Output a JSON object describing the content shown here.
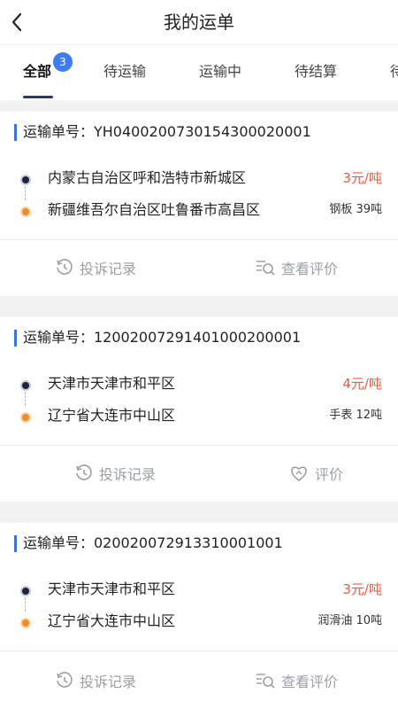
{
  "header": {
    "title": "我的运单"
  },
  "tabs": [
    {
      "label": "全部",
      "badge": "3",
      "active": true
    },
    {
      "label": "待运输"
    },
    {
      "label": "运输中"
    },
    {
      "label": "待结算"
    },
    {
      "label": "待"
    }
  ],
  "orders": [
    {
      "order_label": "运输单号：YH0400200730154300020001",
      "origin": "内蒙古自治区呼和浩特市新城区",
      "destination": "新疆维吾尔自治区吐鲁番市高昌区",
      "price": "3元/吨",
      "cargo": "钢板  39吨",
      "action_left": "投诉记录",
      "action_right": "查看评价"
    },
    {
      "order_label": "运输单号：12002007291401000200001",
      "origin": "天津市天津市和平区",
      "destination": "辽宁省大连市中山区",
      "price": "4元/吨",
      "cargo": "手表  12吨",
      "action_left": "投诉记录",
      "action_right": "评价"
    },
    {
      "order_label": "运输单号：020020072913310001001",
      "origin": "天津市天津市和平区",
      "destination": "辽宁省大连市中山区",
      "price": "3元/吨",
      "cargo": "润滑油  10吨",
      "action_left": "投诉记录",
      "action_right": "查看评价"
    }
  ],
  "colors": {
    "accent": "#3f7bf1",
    "price": "#f05a3a",
    "origin_dot": "#1a2440",
    "dest_dot": "#f18b25"
  }
}
